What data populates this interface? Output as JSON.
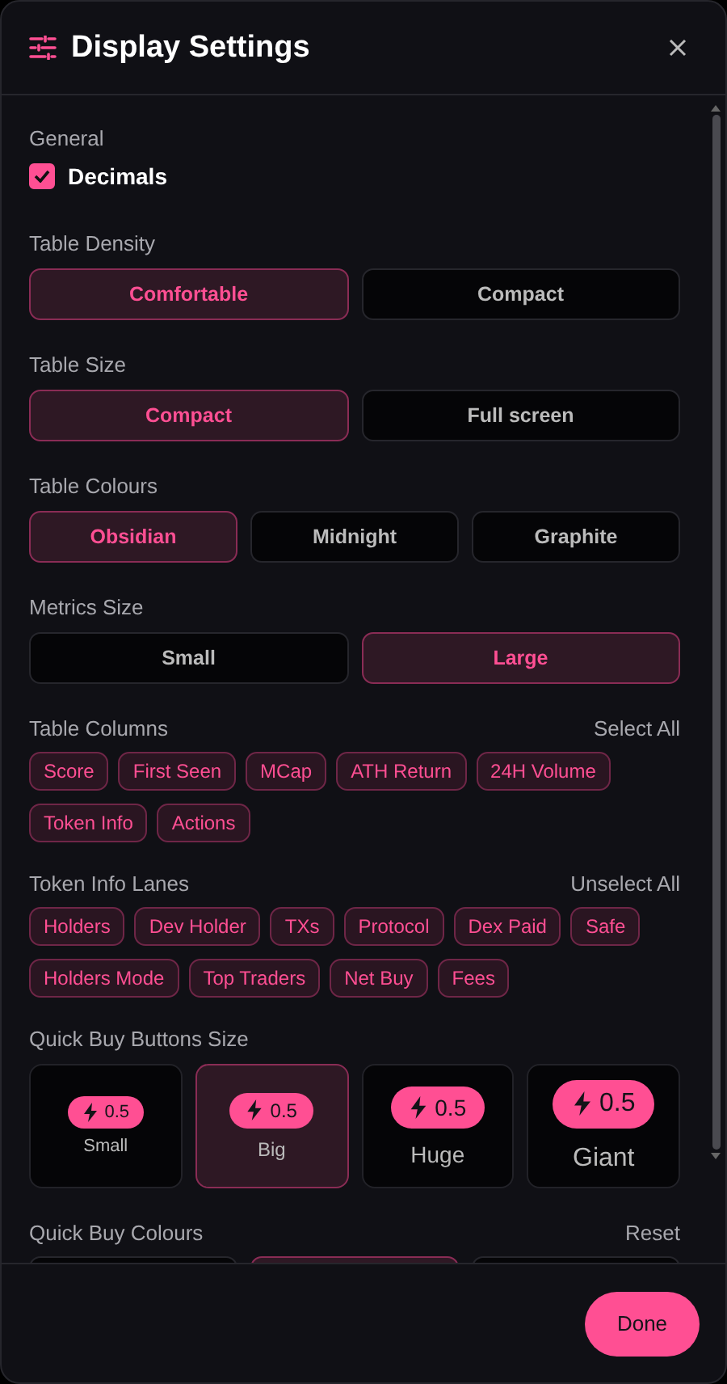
{
  "dialog": {
    "title": "Display Settings"
  },
  "general": {
    "label": "General",
    "decimals": {
      "label": "Decimals",
      "checked": true
    }
  },
  "segments": [
    {
      "label": "Table Density",
      "options": [
        {
          "label": "Comfortable",
          "selected": true
        },
        {
          "label": "Compact",
          "selected": false
        }
      ]
    },
    {
      "label": "Table Size",
      "options": [
        {
          "label": "Compact",
          "selected": true
        },
        {
          "label": "Full screen",
          "selected": false
        }
      ]
    },
    {
      "label": "Table Colours",
      "options": [
        {
          "label": "Obsidian",
          "selected": true
        },
        {
          "label": "Midnight",
          "selected": false
        },
        {
          "label": "Graphite",
          "selected": false
        }
      ]
    },
    {
      "label": "Metrics Size",
      "options": [
        {
          "label": "Small",
          "selected": false
        },
        {
          "label": "Large",
          "selected": true
        }
      ]
    }
  ],
  "chip_groups": [
    {
      "label": "Table Columns",
      "action": "Select All",
      "chips": [
        {
          "label": "Score",
          "selected": true
        },
        {
          "label": "First Seen",
          "selected": true
        },
        {
          "label": "MCap",
          "selected": true
        },
        {
          "label": "ATH Return",
          "selected": true
        },
        {
          "label": "24H Volume",
          "selected": true
        },
        {
          "label": "Token Info",
          "selected": true
        },
        {
          "label": "Actions",
          "selected": true
        }
      ]
    },
    {
      "label": "Token Info Lanes",
      "action": "Unselect All",
      "chips": [
        {
          "label": "Holders",
          "selected": true
        },
        {
          "label": "Dev Holder",
          "selected": true
        },
        {
          "label": "TXs",
          "selected": true
        },
        {
          "label": "Protocol",
          "selected": true
        },
        {
          "label": "Dex Paid",
          "selected": true
        },
        {
          "label": "Safe",
          "selected": true
        },
        {
          "label": "Holders Mode",
          "selected": true
        },
        {
          "label": "Top Traders",
          "selected": true
        },
        {
          "label": "Net Buy",
          "selected": true
        },
        {
          "label": "Fees",
          "selected": true
        }
      ]
    }
  ],
  "quick_buy_size": {
    "label": "Quick Buy Buttons Size",
    "options": [
      {
        "label": "Small",
        "badge": "0.5",
        "kind": "small",
        "selected": false
      },
      {
        "label": "Big",
        "badge": "0.5",
        "kind": "big",
        "selected": true
      },
      {
        "label": "Huge",
        "badge": "0.5",
        "kind": "huge",
        "selected": false
      },
      {
        "label": "Giant",
        "badge": "0.5",
        "kind": "giant",
        "selected": false
      }
    ]
  },
  "quick_buy_colours": {
    "label": "Quick Buy Colours",
    "action": "Reset",
    "options": [
      {
        "selected": false
      },
      {
        "selected": true
      },
      {
        "selected": false
      }
    ]
  },
  "footer": {
    "done": "Done"
  }
}
